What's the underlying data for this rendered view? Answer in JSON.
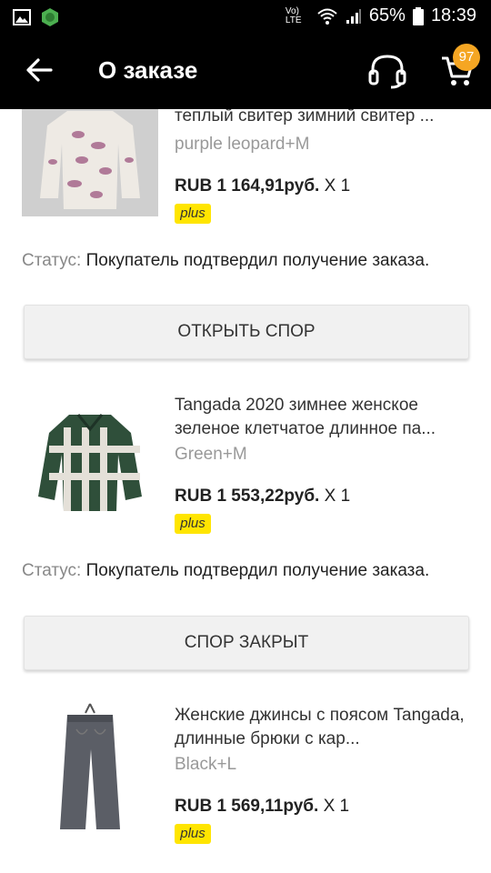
{
  "status_bar": {
    "icons": [
      "image-icon",
      "shield-app-icon",
      "wifi-icon",
      "signal-icon",
      "battery-icon"
    ],
    "network": "Vo) LTE",
    "battery": "65%",
    "time": "18:39"
  },
  "header": {
    "title": "О заказе",
    "cart_count": "97"
  },
  "orders": [
    {
      "name": "теплый свитер зимний свитер ...",
      "variant": "purple leopard+M",
      "price": "RUB 1 164,91руб.",
      "qty": "X 1",
      "badge": "plus",
      "status_label": "Статус:",
      "status_text": "Покупатель подтвердил получение заказа.",
      "button": "ОТКРЫТЬ СПОР"
    },
    {
      "name": "Tangada 2020 зимнее женское зеленое клетчатое длинное па...",
      "variant": "Green+M",
      "price": "RUB 1 553,22руб.",
      "qty": "X 1",
      "badge": "plus",
      "status_label": "Статус:",
      "status_text": "Покупатель подтвердил получение заказа.",
      "button": "СПОР ЗАКРЫТ"
    },
    {
      "name": "Женские джинсы с поясом Tangada, длинные брюки с кар...",
      "variant": "Black+L",
      "price": "RUB 1 569,11руб.",
      "qty": "X 1",
      "badge": "plus"
    }
  ],
  "colors": {
    "appbar": "#000000",
    "badge": "#f5a623",
    "plus_badge": "#ffe500"
  }
}
